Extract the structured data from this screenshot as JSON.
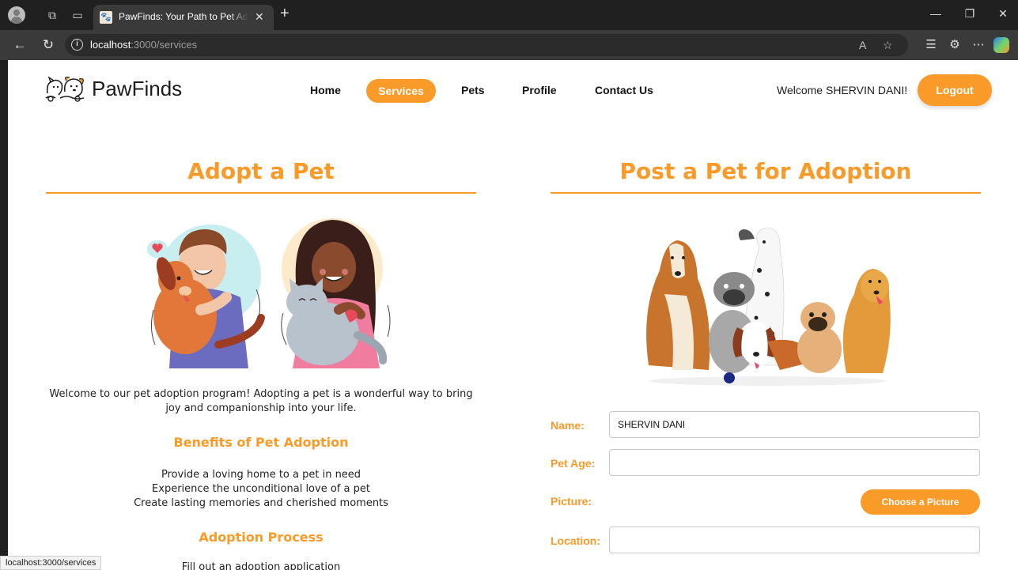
{
  "browser": {
    "tab_title": "PawFinds: Your Path to Pet Adoption",
    "url_host": "localhost",
    "url_path": ":3000/services",
    "status_url": "localhost:3000/services"
  },
  "header": {
    "logo_text": "PawFinds",
    "nav": {
      "home": "Home",
      "services": "Services",
      "pets": "Pets",
      "profile": "Profile",
      "contact": "Contact Us"
    },
    "welcome": "Welcome SHERVIN DANI!",
    "logout": "Logout"
  },
  "adopt": {
    "title": "Adopt a Pet",
    "intro": "Welcome to our pet adoption program! Adopting a pet is a wonderful way to bring joy and companionship into your life.",
    "benefits_title": "Benefits of Pet Adoption",
    "benefits": [
      "Provide a loving home to a pet in need",
      "Experience the unconditional love of a pet",
      "Create lasting memories and cherished moments"
    ],
    "process_title": "Adoption Process",
    "process_first": "Fill out an adoption application"
  },
  "post": {
    "title": "Post a Pet for Adoption",
    "name_label": "Name:",
    "name_value": "SHERVIN DANI",
    "age_label": "Pet Age:",
    "age_value": "",
    "picture_label": "Picture:",
    "choose_button": "Choose a Picture",
    "location_label": "Location:",
    "location_value": ""
  },
  "colors": {
    "accent": "#fa9a28",
    "text": "#222222",
    "chrome_dark": "#202020",
    "chrome_bar": "#3a3a3a"
  }
}
